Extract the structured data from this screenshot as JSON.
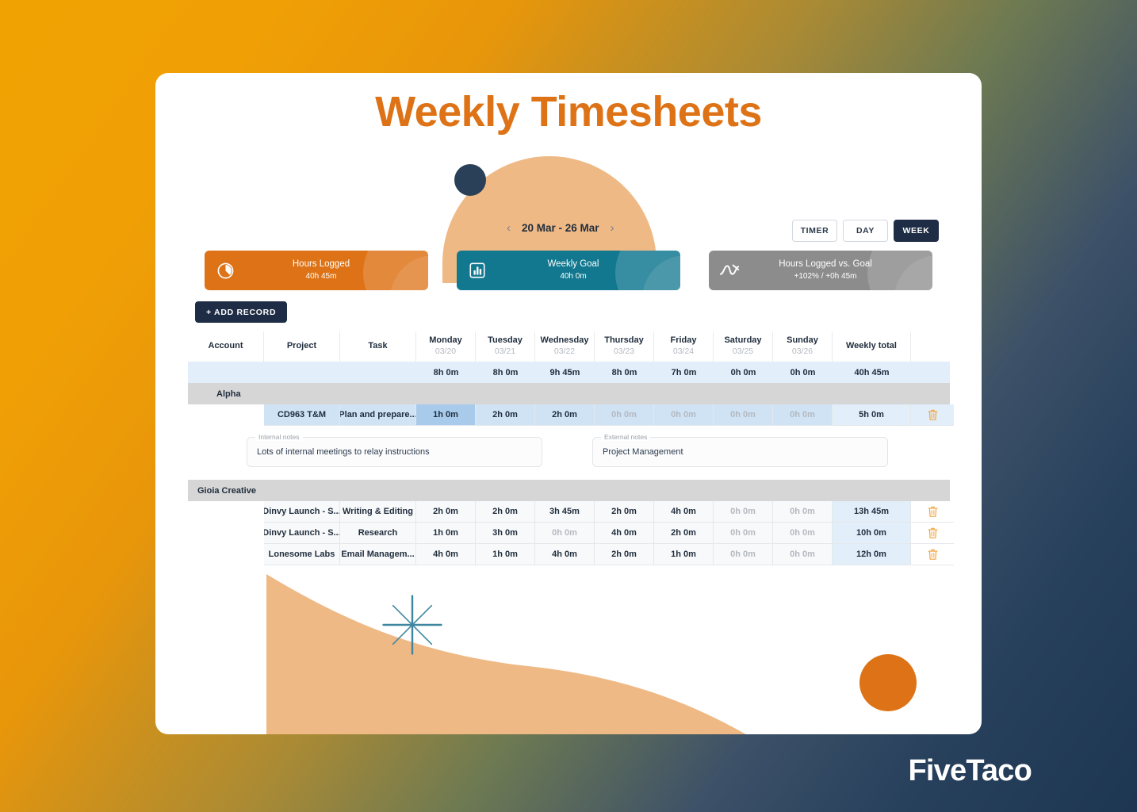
{
  "page": {
    "title": "Weekly Timesheets",
    "brand": "FiveTaco",
    "accent_orange": "#dd7316",
    "accent_teal": "#11788f",
    "accent_navy": "#1e2d45",
    "bg_gradient_start": "#f0a202",
    "bg_gradient_end": "#1d3651"
  },
  "datenav": {
    "prev_icon": "chevron-left-icon",
    "range": "20 Mar - 26 Mar",
    "next_icon": "chevron-right-icon"
  },
  "view_toggle": {
    "options": [
      {
        "label": "TIMER",
        "active": false
      },
      {
        "label": "DAY",
        "active": false
      },
      {
        "label": "WEEK",
        "active": true
      }
    ]
  },
  "stats": [
    {
      "icon": "clock-pie-icon",
      "label": "Hours Logged",
      "value": "40h 45m",
      "color": "#dd7316"
    },
    {
      "icon": "bar-chart-icon",
      "label": "Weekly Goal",
      "value": "40h 0m",
      "color": "#11788f"
    },
    {
      "icon": "trend-line-icon",
      "label": "Hours Logged vs. Goal",
      "value": "+102% / +0h 45m",
      "color": "#8c8c8c"
    }
  ],
  "toolbar": {
    "add_record_label": "+ ADD RECORD"
  },
  "table": {
    "headers": [
      {
        "title": "Account",
        "sub": ""
      },
      {
        "title": "Project",
        "sub": ""
      },
      {
        "title": "Task",
        "sub": ""
      },
      {
        "title": "Monday",
        "sub": "03/20"
      },
      {
        "title": "Tuesday",
        "sub": "03/21"
      },
      {
        "title": "Wednesday",
        "sub": "03/22"
      },
      {
        "title": "Thursday",
        "sub": "03/23"
      },
      {
        "title": "Friday",
        "sub": "03/24"
      },
      {
        "title": "Saturday",
        "sub": "03/25"
      },
      {
        "title": "Sunday",
        "sub": "03/26"
      },
      {
        "title": "Weekly total",
        "sub": ""
      },
      {
        "title": "",
        "sub": ""
      }
    ],
    "totals_row": {
      "monday": "8h 0m",
      "tuesday": "8h 0m",
      "wednesday": "9h 45m",
      "thursday": "8h 0m",
      "friday": "7h 0m",
      "saturday": "0h 0m",
      "sunday": "0h 0m",
      "weekly_total": "40h 45m"
    },
    "groups": [
      {
        "name": "Alpha",
        "indent": true,
        "rows": [
          {
            "account": "",
            "project": "CD963 T&M",
            "task": "Plan and prepare...",
            "days": [
              "1h 0m",
              "2h 0m",
              "2h 0m",
              "0h 0m",
              "0h 0m",
              "0h 0m",
              "0h 0m"
            ],
            "total": "5h 0m",
            "selected": true,
            "selected_day_index": 0,
            "delete_icon": "trash-icon",
            "notes": {
              "internal_caption": "Internal notes",
              "internal_value": "Lots of internal meetings to relay instructions",
              "external_caption": "External notes",
              "external_value": "Project Management"
            }
          }
        ]
      },
      {
        "name": "Gioia Creative",
        "indent": false,
        "rows": [
          {
            "account": "",
            "project": "Dinvy Launch - S...",
            "task": "Writing & Editing",
            "days": [
              "2h 0m",
              "2h 0m",
              "3h 45m",
              "2h 0m",
              "4h 0m",
              "0h 0m",
              "0h 0m"
            ],
            "total": "13h 45m",
            "selected": false,
            "delete_icon": "trash-icon"
          },
          {
            "account": "",
            "project": "Dinvy Launch - S...",
            "task": "Research",
            "days": [
              "1h 0m",
              "3h 0m",
              "0h 0m",
              "4h 0m",
              "2h 0m",
              "0h 0m",
              "0h 0m"
            ],
            "total": "10h 0m",
            "selected": false,
            "delete_icon": "trash-icon"
          },
          {
            "account": "",
            "project": "Lonesome Labs",
            "task": "Email Managem...",
            "days": [
              "4h 0m",
              "1h 0m",
              "4h 0m",
              "2h 0m",
              "1h 0m",
              "0h 0m",
              "0h 0m"
            ],
            "total": "12h 0m",
            "selected": false,
            "delete_icon": "trash-icon"
          }
        ]
      }
    ]
  }
}
